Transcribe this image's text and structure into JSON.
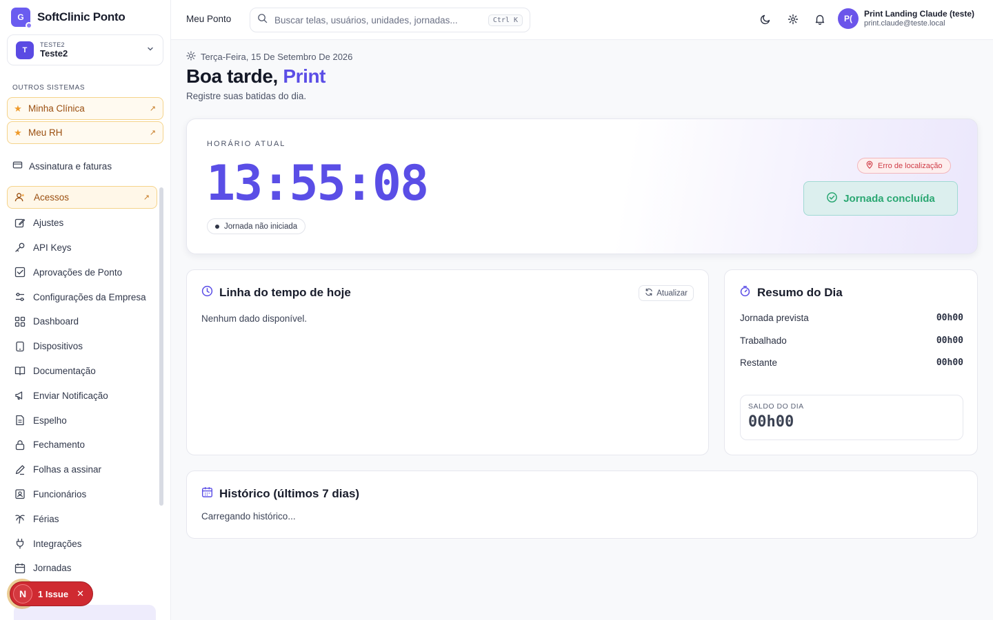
{
  "app": {
    "name": "SoftClinic Ponto",
    "logo_letter": "G"
  },
  "tenant": {
    "avatar": "T",
    "code": "TESTE2",
    "name": "Teste2"
  },
  "sidebar": {
    "section_label": "OUTROS SISTEMAS",
    "external": [
      {
        "label": "Minha Clínica"
      },
      {
        "label": "Meu RH"
      }
    ],
    "billing_label": "Assinatura e faturas",
    "items": [
      {
        "label": "Acessos",
        "icon": "users-icon"
      },
      {
        "label": "Ajustes",
        "icon": "edit-icon"
      },
      {
        "label": "API Keys",
        "icon": "key-icon"
      },
      {
        "label": "Aprovações de Ponto",
        "icon": "check-square-icon"
      },
      {
        "label": "Configurações da Empresa",
        "icon": "sliders-icon"
      },
      {
        "label": "Dashboard",
        "icon": "grid-icon"
      },
      {
        "label": "Dispositivos",
        "icon": "tablet-icon"
      },
      {
        "label": "Documentação",
        "icon": "book-icon"
      },
      {
        "label": "Enviar Notificação",
        "icon": "megaphone-icon"
      },
      {
        "label": "Espelho",
        "icon": "file-icon"
      },
      {
        "label": "Fechamento",
        "icon": "lock-icon"
      },
      {
        "label": "Folhas a assinar",
        "icon": "pen-icon"
      },
      {
        "label": "Funcionários",
        "icon": "id-badge-icon"
      },
      {
        "label": "Férias",
        "icon": "palm-icon"
      },
      {
        "label": "Integrações",
        "icon": "plug-icon"
      },
      {
        "label": "Jornadas",
        "icon": "calendar-icon"
      }
    ]
  },
  "issue": {
    "letter": "N",
    "label": "1 Issue"
  },
  "header": {
    "title": "Meu Ponto",
    "search_placeholder": "Buscar telas, usuários, unidades, jornadas...",
    "shortcut": "Ctrl K",
    "user": {
      "initials": "P(",
      "name": "Print Landing Claude (teste)",
      "email": "print.claude@teste.local"
    }
  },
  "main": {
    "date": "Terça-Feira, 15 De Setembro De 2026",
    "greeting": "Boa tarde,",
    "greeting_name": "Print",
    "subtitle": "Registre suas batidas do dia.",
    "clock": {
      "label": "HORÁRIO ATUAL",
      "time": "13:55:08",
      "status": "Jornada não iniciada",
      "location_error": "Erro de localização",
      "done_label": "Jornada concluída"
    },
    "timeline": {
      "title": "Linha do tempo de hoje",
      "refresh": "Atualizar",
      "empty": "Nenhum dado disponível."
    },
    "summary": {
      "title": "Resumo do Dia",
      "rows": [
        {
          "label": "Jornada prevista",
          "value": "00h00"
        },
        {
          "label": "Trabalhado",
          "value": "00h00"
        },
        {
          "label": "Restante",
          "value": "00h00"
        }
      ],
      "saldo_label": "SALDO DO DIA",
      "saldo_value": "00h00"
    },
    "history": {
      "title": "Histórico (últimos 7 dias)",
      "loading": "Carregando histórico..."
    }
  },
  "colors": {
    "accent": "#5b4ee6",
    "warning": "#f5d38a",
    "success": "#2aa772",
    "danger": "#cf3a45"
  }
}
